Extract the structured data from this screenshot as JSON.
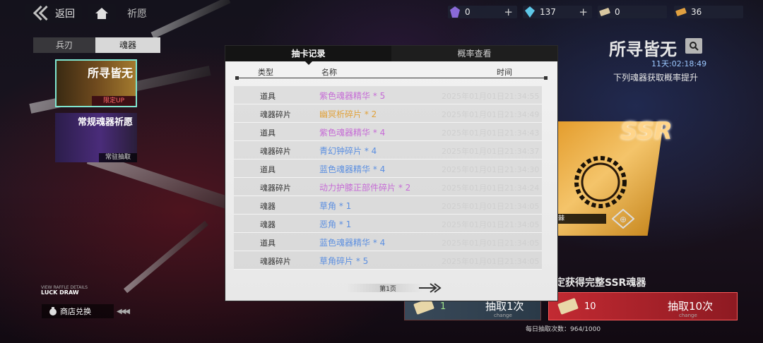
{
  "topbar": {
    "back_label": "返回",
    "breadcrumb": "祈愿"
  },
  "currencies": [
    {
      "icon": "purple-crystal-icon",
      "value": "0"
    },
    {
      "icon": "blue-crystal-icon",
      "value": "137"
    },
    {
      "icon": "ticket-icon",
      "value": "0"
    },
    {
      "icon": "gold-ticket-icon",
      "value": "36"
    }
  ],
  "left_tabs": {
    "weapon": "兵刃",
    "soul": "魂器"
  },
  "banners": [
    {
      "title": "所寻皆无",
      "tag": "限定UP"
    },
    {
      "title": "常规魂器祈愿",
      "tag": "常驻抽取"
    }
  ],
  "luck": {
    "line1": "VIEW RAFFLE DETAILS",
    "line2": "LUCK DRAW"
  },
  "shop": {
    "label": "商店兑换"
  },
  "right": {
    "title": "所寻皆无",
    "timer": "11天:02:18:49",
    "subtitle": "下列魂器获取概率提升",
    "ssr_label": "SSR",
    "item_name": "棘",
    "promo": "定获得完整SSR魂器",
    "draw_one": {
      "count": "1",
      "label": "抽取1次",
      "sub": "change"
    },
    "draw_ten": {
      "count": "10",
      "label": "抽取10次",
      "sub": "change"
    },
    "daily": "每日抽取次数：964/1000"
  },
  "modal": {
    "tabs": [
      "抽卡记录",
      "概率查看"
    ],
    "headers": {
      "type": "类型",
      "name": "名称",
      "time": "时间"
    },
    "records": [
      {
        "type": "道具",
        "name": "紫色魂器精华 * 5",
        "time": "2025年01月01日21:34:55",
        "color": "#c66cd6"
      },
      {
        "type": "魂器碎片",
        "name": "幽冥析碎片 * 2",
        "time": "2025年01月01日21:34:49",
        "color": "#e0a13a"
      },
      {
        "type": "道具",
        "name": "紫色魂器精华 * 4",
        "time": "2025年01月01日21:34:43",
        "color": "#c66cd6"
      },
      {
        "type": "魂器碎片",
        "name": "青幻钟碎片 * 4",
        "time": "2025年01月01日21:34:37",
        "color": "#5c8fe0"
      },
      {
        "type": "道具",
        "name": "蓝色魂器精华 * 4",
        "time": "2025年01月01日21:34:30",
        "color": "#5c8fe0"
      },
      {
        "type": "魂器碎片",
        "name": "动力护膝正部件碎片 * 2",
        "time": "2025年01月01日21:34:24",
        "color": "#c66cd6"
      },
      {
        "type": "魂器",
        "name": "草角 * 1",
        "time": "2025年01月01日21:34:05",
        "color": "#5c8fe0"
      },
      {
        "type": "魂器",
        "name": "恶角 * 1",
        "time": "2025年01月01日21:34:05",
        "color": "#5c8fe0"
      },
      {
        "type": "道具",
        "name": "蓝色魂器精华 * 4",
        "time": "2025年01月01日21:34:05",
        "color": "#5c8fe0"
      },
      {
        "type": "魂器碎片",
        "name": "草角碎片 * 5",
        "time": "2025年01月01日21:34:05",
        "color": "#5c8fe0"
      }
    ],
    "page_label": "第1页"
  }
}
